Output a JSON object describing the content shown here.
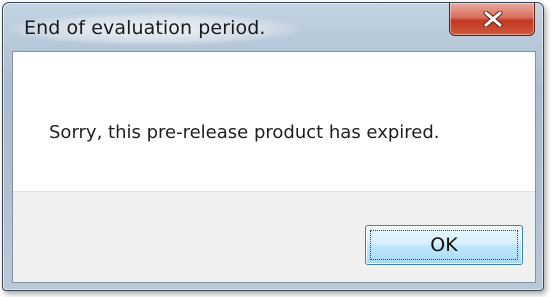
{
  "window": {
    "title": "End of evaluation period.",
    "close_icon": "close-icon",
    "close_button_color": "#c7442b"
  },
  "dialog": {
    "message": "Sorry, this pre-release product has expired.",
    "ok_label": "OK",
    "ok_button_color": "#bee6fd"
  }
}
